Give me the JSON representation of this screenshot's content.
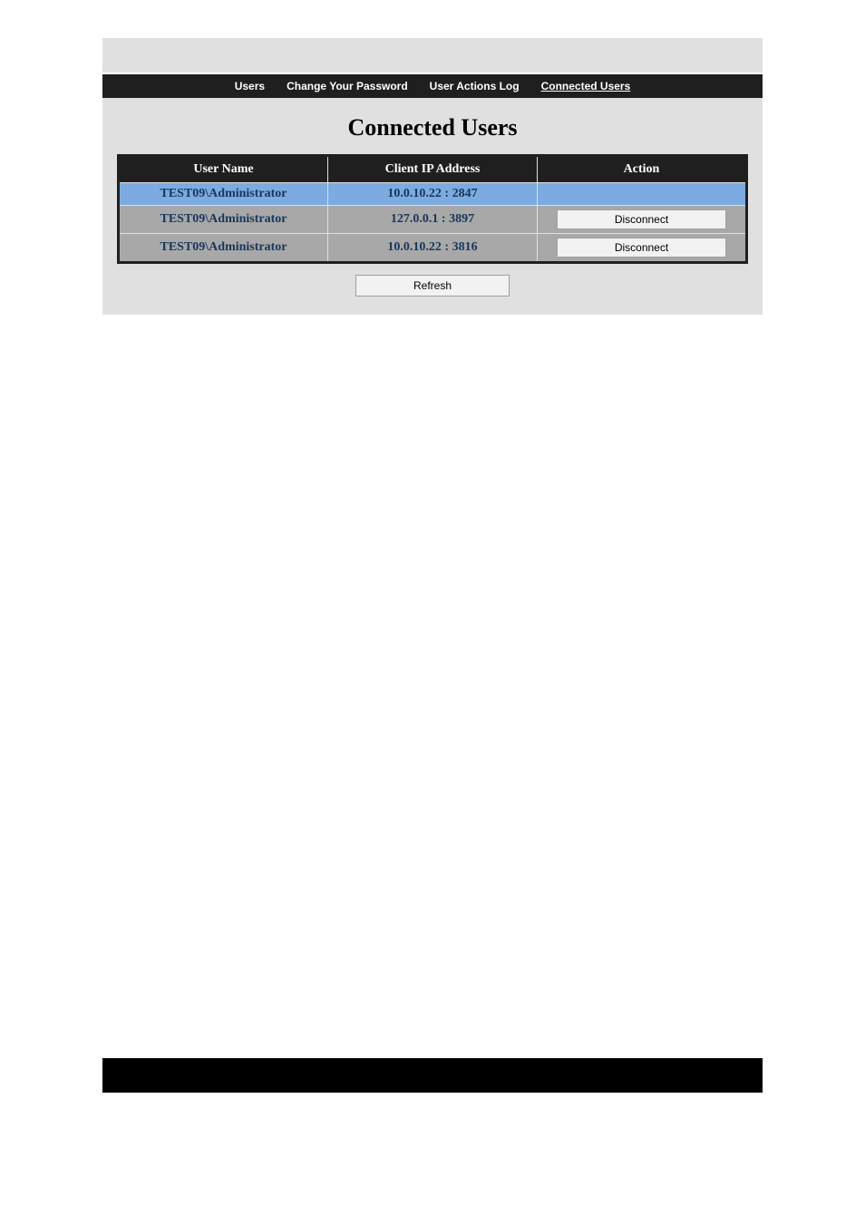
{
  "nav": {
    "items": [
      {
        "label": "Users",
        "active": false
      },
      {
        "label": "Change Your Password",
        "active": false
      },
      {
        "label": "User Actions Log",
        "active": false
      },
      {
        "label": "Connected Users",
        "active": true
      }
    ]
  },
  "page_title": "Connected Users",
  "table": {
    "headers": {
      "user": "User Name",
      "ip": "Client IP Address",
      "action": "Action"
    },
    "rows": [
      {
        "user": "TEST09\\Administrator",
        "ip": "10.0.10.22 : 2847",
        "selected": true,
        "has_action": false
      },
      {
        "user": "TEST09\\Administrator",
        "ip": "127.0.0.1 : 3897",
        "selected": false,
        "has_action": true
      },
      {
        "user": "TEST09\\Administrator",
        "ip": "10.0.10.22 : 3816",
        "selected": false,
        "has_action": true
      }
    ],
    "disconnect_label": "Disconnect"
  },
  "refresh_label": "Refresh"
}
